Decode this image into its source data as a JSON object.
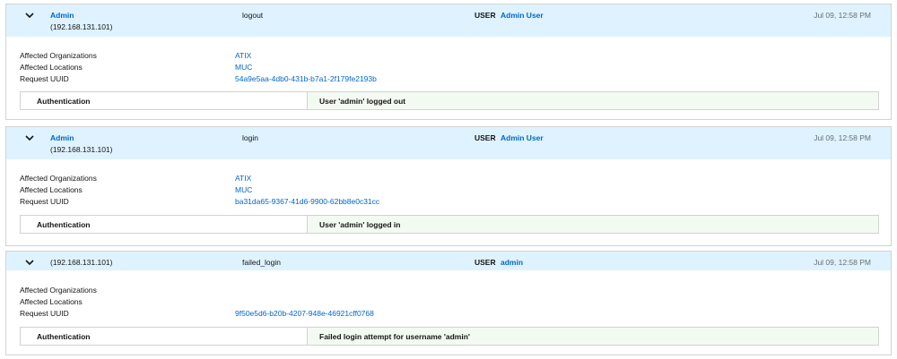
{
  "entries": [
    {
      "user": "Admin",
      "ip": "(192.168.131.101)",
      "action": "logout",
      "type_label": "USER",
      "type_value": "Admin User",
      "time": "Jul 09, 12:58 PM",
      "details": {
        "orgs_label": "Affected Organizations",
        "orgs_value": "ATIX",
        "locs_label": "Affected Locations",
        "locs_value": "MUC",
        "uuid_label": "Request UUID",
        "uuid_value": "54a9e5aa-4db0-431b-b7a1-2f179fe2193b"
      },
      "audit": {
        "key": "Authentication",
        "message": "User 'admin' logged out"
      }
    },
    {
      "user": "Admin",
      "ip": "(192.168.131.101)",
      "action": "login",
      "type_label": "USER",
      "type_value": "Admin User",
      "time": "Jul 09, 12:58 PM",
      "details": {
        "orgs_label": "Affected Organizations",
        "orgs_value": "ATIX",
        "locs_label": "Affected Locations",
        "locs_value": "MUC",
        "uuid_label": "Request UUID",
        "uuid_value": "ba31da65-9367-41d6-9900-62bb8e0c31cc"
      },
      "audit": {
        "key": "Authentication",
        "message": "User 'admin' logged in"
      }
    },
    {
      "user": "",
      "ip": "(192.168.131.101)",
      "action": "failed_login",
      "type_label": "USER",
      "type_value": "admin",
      "time": "Jul 09, 12:58 PM",
      "details": {
        "orgs_label": "Affected Organizations",
        "orgs_value": "",
        "locs_label": "Affected Locations",
        "locs_value": "",
        "uuid_label": "Request UUID",
        "uuid_value": "9f50e5d6-b20b-4207-948e-46921cff0768"
      },
      "audit": {
        "key": "Authentication",
        "message": "Failed login attempt for username 'admin'"
      }
    }
  ],
  "icons": {
    "toggle": "chevron-down-icon"
  },
  "colors": {
    "header_bg": "#def3ff",
    "link": "#0066cc",
    "message_bg": "#f3faf2",
    "border": "#d2d2d2"
  }
}
